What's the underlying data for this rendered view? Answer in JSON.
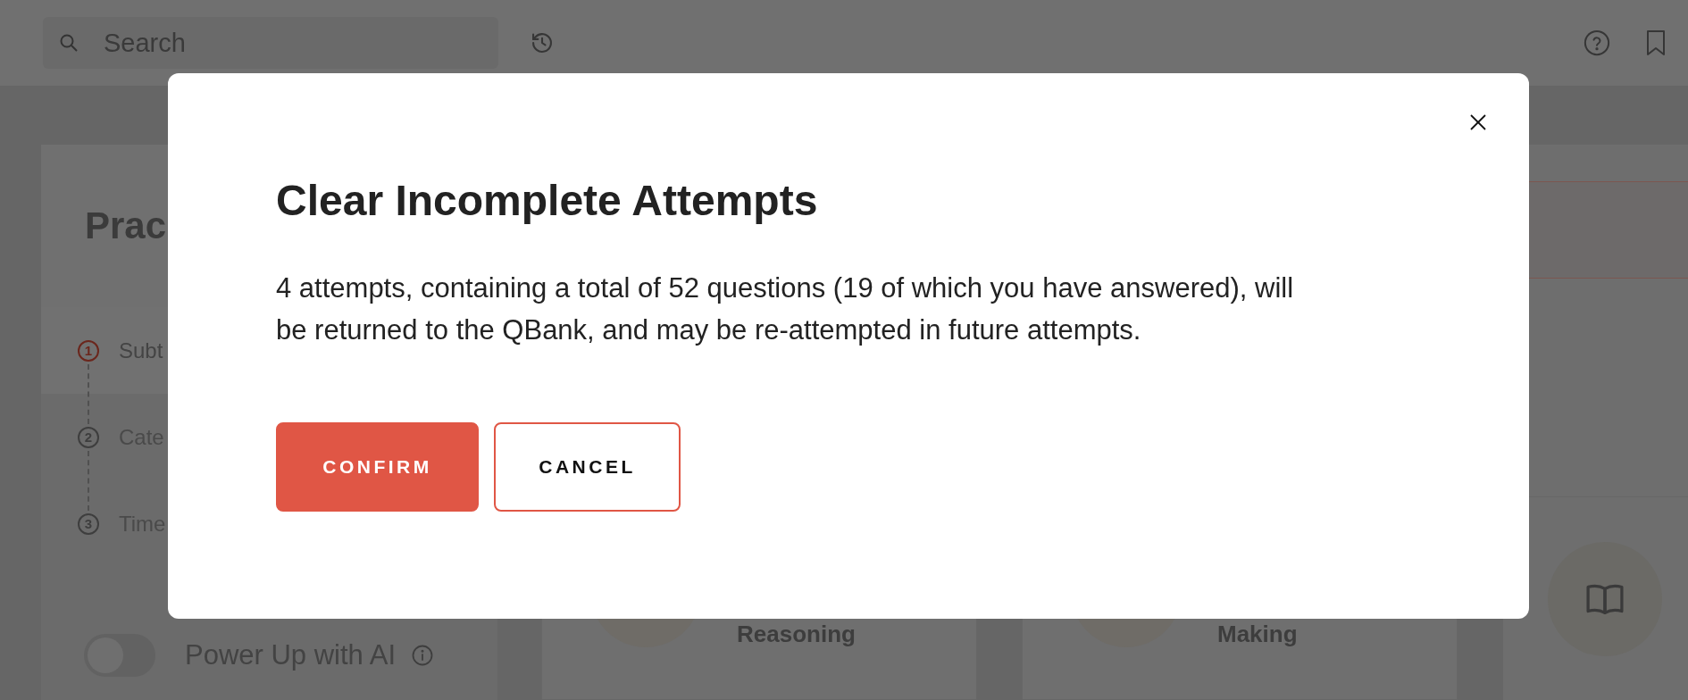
{
  "top_bar": {
    "search": {
      "placeholder": "Search"
    }
  },
  "practice_panel": {
    "title": "Prac",
    "steps": [
      {
        "number": "1",
        "label": "Subt",
        "selected": true
      },
      {
        "number": "2",
        "label": "Cate",
        "selected": false
      },
      {
        "number": "3",
        "label": "Time",
        "selected": false
      }
    ],
    "ai_toggle": {
      "label": "Power Up with AI",
      "on": false
    }
  },
  "cards": [
    {
      "title": "Reasoning"
    },
    {
      "title": "Making"
    }
  ],
  "dialog": {
    "title": "Clear Incomplete Attempts",
    "message": "4 attempts, containing a total of 52 questions (19 of which you have answered), will be returned to the QBank, and may be re-attempted in future attempts.",
    "buttons": [
      {
        "label": "CONFIRM",
        "kind": "primary"
      },
      {
        "label": "CANCEL",
        "kind": "secondary"
      }
    ]
  }
}
